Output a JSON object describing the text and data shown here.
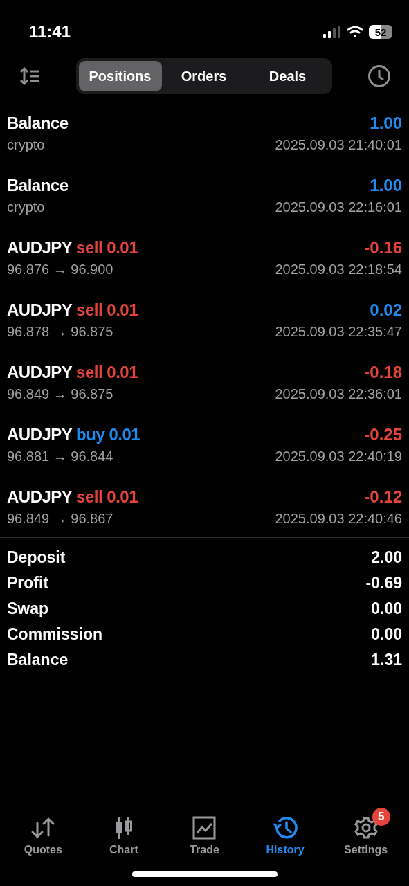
{
  "status_bar": {
    "time": "11:41",
    "battery": "52"
  },
  "tabs": [
    {
      "label": "Positions",
      "selected": true
    },
    {
      "label": "Orders",
      "selected": false
    },
    {
      "label": "Deals",
      "selected": false
    }
  ],
  "deals": [
    {
      "kind": "balance",
      "title": "Balance",
      "subtitle": "crypto",
      "value": "1.00",
      "color": "#1f8bf0",
      "time": "2025.09.03 21:40:01"
    },
    {
      "kind": "balance",
      "title": "Balance",
      "subtitle": "crypto",
      "value": "1.00",
      "color": "#1f8bf0",
      "time": "2025.09.03 22:16:01"
    },
    {
      "kind": "trade",
      "symbol": "AUDJPY",
      "side": "sell",
      "volume": "0.01",
      "prices": "96.876 → 96.900",
      "value": "-0.16",
      "color": "#e5443a",
      "time": "2025.09.03 22:18:54"
    },
    {
      "kind": "trade",
      "symbol": "AUDJPY",
      "side": "sell",
      "volume": "0.01",
      "prices": "96.878 → 96.875",
      "value": "0.02",
      "color": "#1f8bf0",
      "time": "2025.09.03 22:35:47"
    },
    {
      "kind": "trade",
      "symbol": "AUDJPY",
      "side": "sell",
      "volume": "0.01",
      "prices": "96.849 → 96.875",
      "value": "-0.18",
      "color": "#e5443a",
      "time": "2025.09.03 22:36:01"
    },
    {
      "kind": "trade",
      "symbol": "AUDJPY",
      "side": "buy",
      "volume": "0.01",
      "prices": "96.881 → 96.844",
      "value": "-0.25",
      "color": "#e5443a",
      "time": "2025.09.03 22:40:19"
    },
    {
      "kind": "trade",
      "symbol": "AUDJPY",
      "side": "sell",
      "volume": "0.01",
      "prices": "96.849 → 96.867",
      "value": "-0.12",
      "color": "#e5443a",
      "time": "2025.09.03 22:40:46"
    }
  ],
  "summary": [
    {
      "label": "Deposit",
      "value": "2.00"
    },
    {
      "label": "Profit",
      "value": "-0.69"
    },
    {
      "label": "Swap",
      "value": "0.00"
    },
    {
      "label": "Commission",
      "value": "0.00"
    },
    {
      "label": "Balance",
      "value": "1.31"
    }
  ],
  "nav": [
    {
      "label": "Quotes",
      "selected": false
    },
    {
      "label": "Chart",
      "selected": false
    },
    {
      "label": "Trade",
      "selected": false
    },
    {
      "label": "History",
      "selected": true
    },
    {
      "label": "Settings",
      "selected": false,
      "badge": "5"
    }
  ]
}
